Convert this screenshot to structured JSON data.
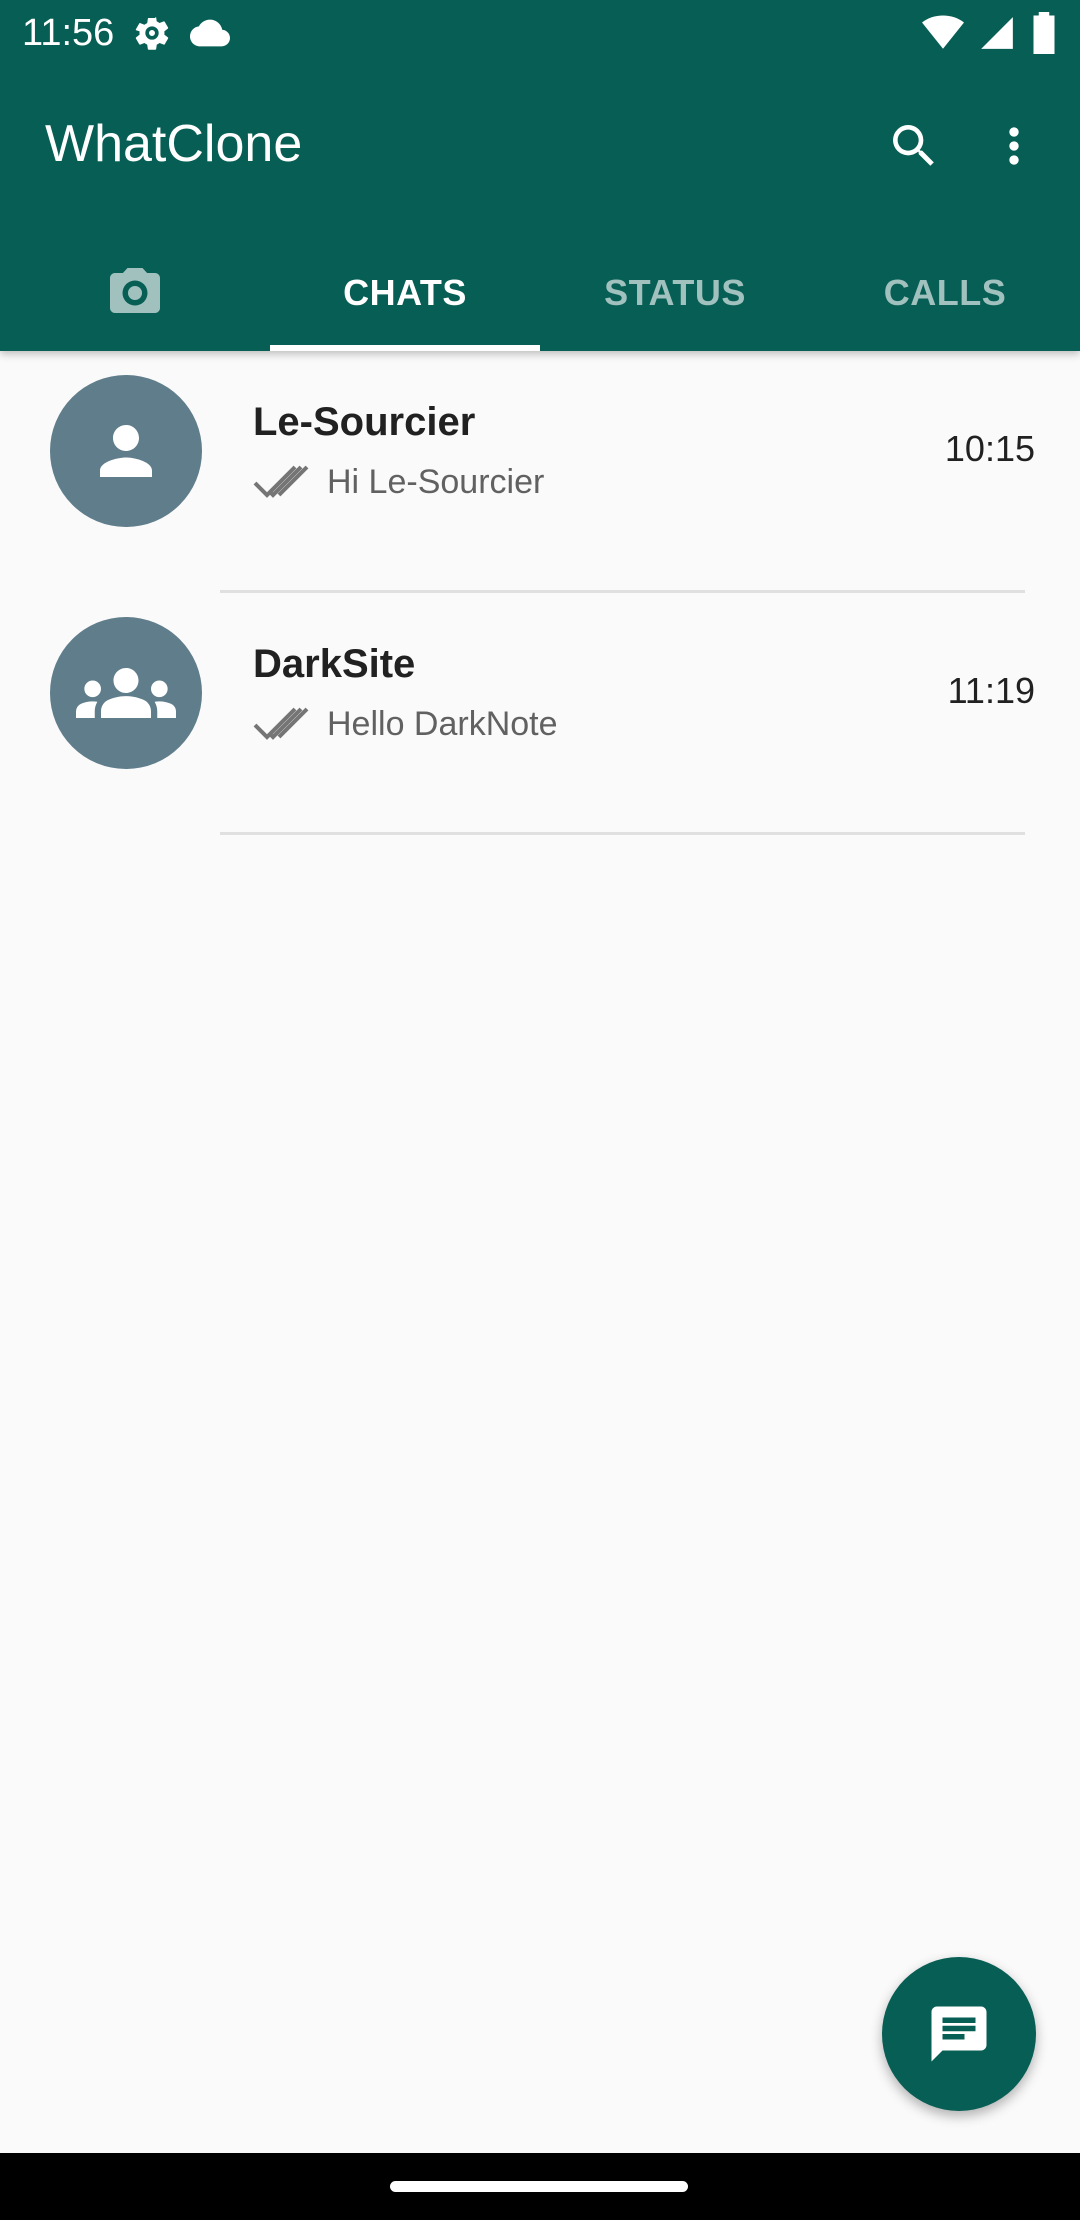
{
  "status_bar": {
    "time": "11:56",
    "left_icons": [
      "settings-gear-icon",
      "cloud-icon"
    ],
    "right_icons": [
      "wifi-icon",
      "cellular-signal-icon",
      "battery-icon"
    ]
  },
  "toolbar": {
    "title": "WhatClone",
    "actions": [
      "search-icon",
      "more-vertical-icon"
    ]
  },
  "tabs": [
    {
      "label": "",
      "icon": "camera-icon",
      "active": false
    },
    {
      "label": "CHATS",
      "active": true
    },
    {
      "label": "STATUS",
      "active": false
    },
    {
      "label": "CALLS",
      "active": false
    }
  ],
  "chats": [
    {
      "name": "Le-Sourcier",
      "preview": "Hi Le-Sourcier",
      "time": "10:15",
      "avatar_icon": "person-icon",
      "ticks": "double-check-icon"
    },
    {
      "name": "DarkSite",
      "preview": "Hello DarkNote",
      "time": "11:19",
      "avatar_icon": "group-icon",
      "ticks": "double-check-icon"
    }
  ],
  "fab": {
    "icon": "message-icon"
  },
  "colors": {
    "primary": "#075e54",
    "avatar_bg": "#607d8b",
    "background": "#fafafa"
  }
}
